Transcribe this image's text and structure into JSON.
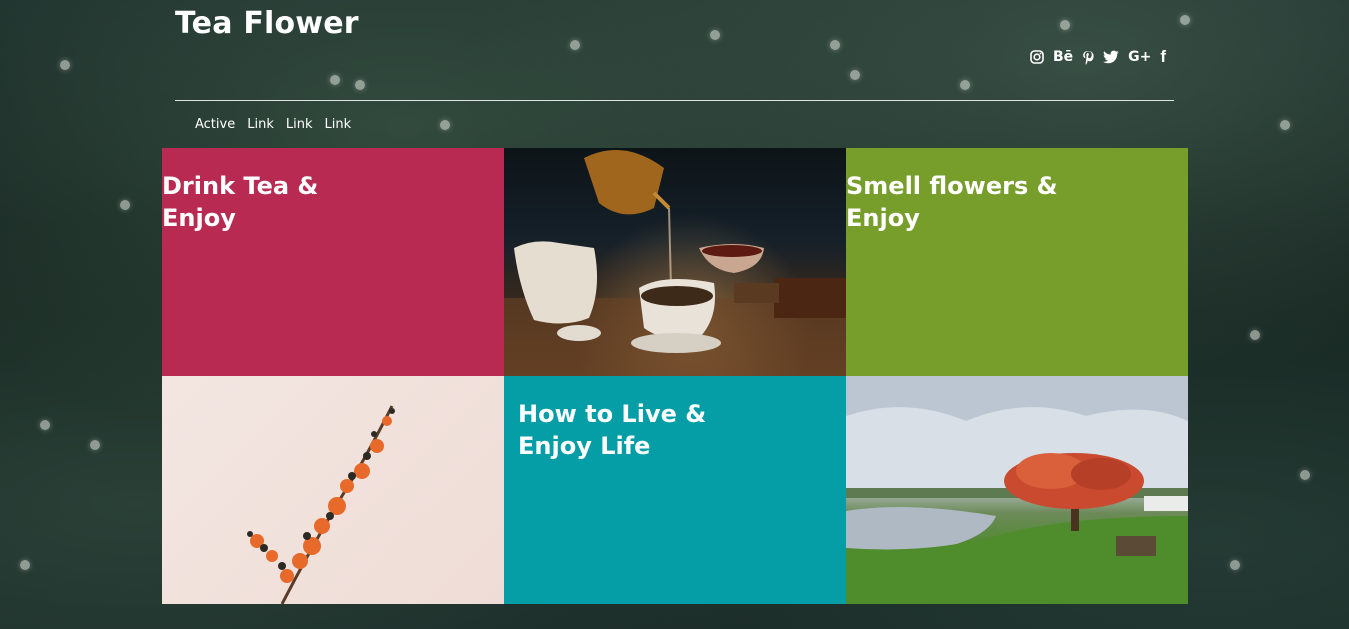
{
  "header": {
    "site_title": "Tea Flower",
    "social_icons": [
      "instagram-icon",
      "behance-icon",
      "pinterest-icon",
      "twitter-icon",
      "google-plus-icon",
      "facebook-icon"
    ],
    "behance_label": "Bē",
    "google_plus_label": "G+",
    "facebook_label": "f"
  },
  "nav": {
    "items": [
      {
        "label": "Active"
      },
      {
        "label": "Link"
      },
      {
        "label": "Link"
      },
      {
        "label": "Link"
      }
    ]
  },
  "tiles": {
    "drink_tea": {
      "title": "Drink Tea & Enjoy",
      "color": "#b82a51"
    },
    "tea_photo": {
      "alt": "tea-pouring-photo"
    },
    "smell_flowers": {
      "title": "Smell flowers & Enjoy",
      "color": "#779d2b"
    },
    "flower_photo": {
      "alt": "flower-branch-photo"
    },
    "how_to_live": {
      "title": "How to Live & Enjoy Life",
      "color": "#059ea7"
    },
    "park_photo": {
      "alt": "park-tree-photo"
    }
  }
}
